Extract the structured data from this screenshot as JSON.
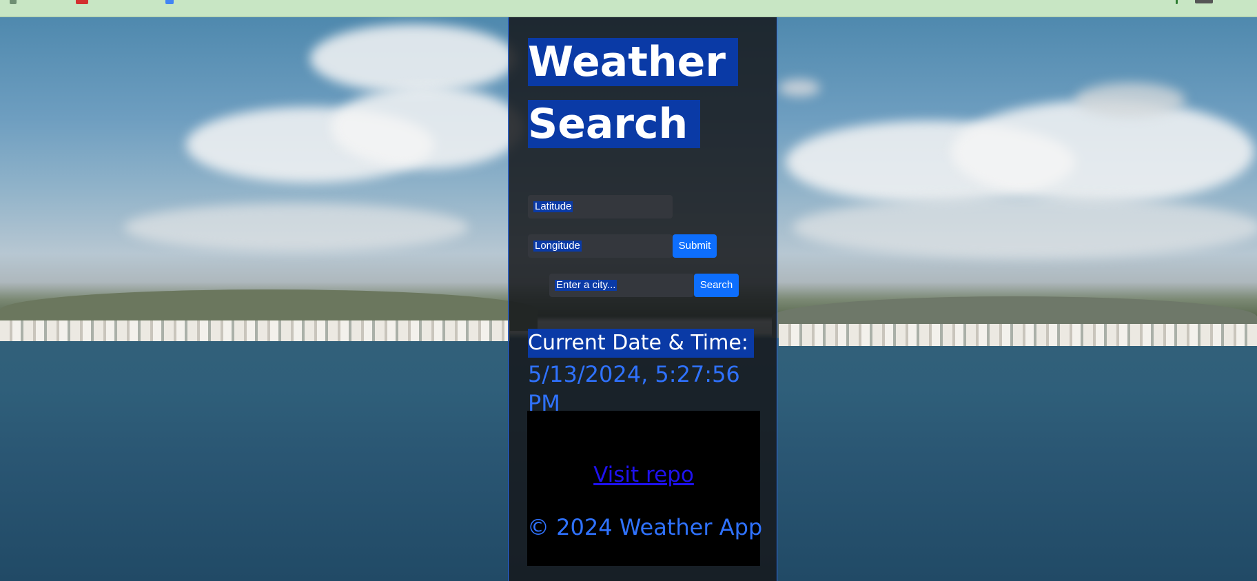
{
  "app": {
    "title_lines": [
      "Weather",
      "Search"
    ]
  },
  "coords_form": {
    "latitude_placeholder": "Latitude",
    "longitude_placeholder": "Longitude",
    "submit_label": "Submit"
  },
  "city_form": {
    "city_placeholder": "Enter a city...",
    "search_label": "Search"
  },
  "datetime": {
    "label": "Current Date & Time:",
    "value": "5/13/2024, 5:27:56 PM"
  },
  "footer": {
    "repo_link": "Visit repo",
    "copyright": "© 2024 Weather App"
  },
  "colors": {
    "accent": "#0d6efd",
    "highlight": "#0a3aa6",
    "datetime_text": "#2f72ff",
    "link": "#1f12ee"
  }
}
